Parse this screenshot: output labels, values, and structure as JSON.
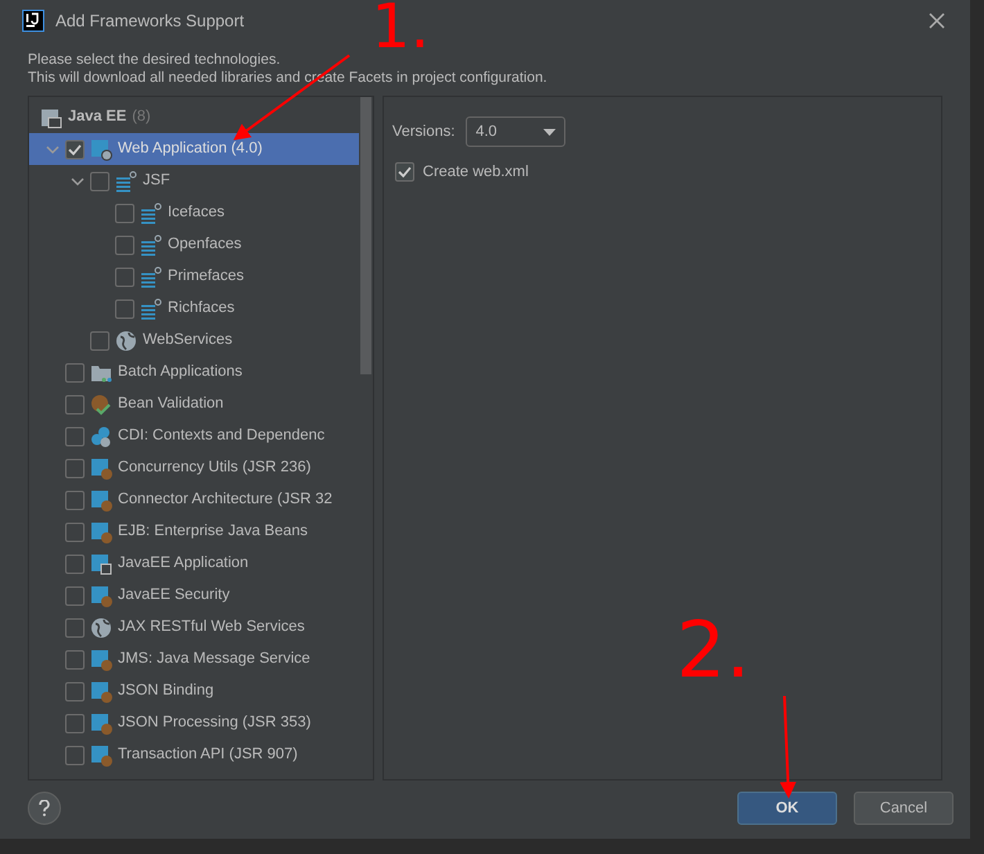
{
  "window": {
    "title": "Add Frameworks Support"
  },
  "description": [
    "Please select the desired technologies.",
    "This will download all needed libraries and create Facets in project configuration."
  ],
  "tree": {
    "group": {
      "label": "Java EE",
      "count": "(8)"
    },
    "items": [
      {
        "label": "Web Application (4.0)",
        "kind": "web",
        "checked": true,
        "selected": true,
        "expanded": true,
        "children": [
          {
            "label": "JSF",
            "kind": "jsf",
            "checked": false,
            "selected": false,
            "expanded": true,
            "children": [
              {
                "label": "Icefaces",
                "kind": "jsf",
                "checked": false,
                "selected": false
              },
              {
                "label": "Openfaces",
                "kind": "jsf",
                "checked": false,
                "selected": false
              },
              {
                "label": "Primefaces",
                "kind": "jsf",
                "checked": false,
                "selected": false
              },
              {
                "label": "Richfaces",
                "kind": "jsf",
                "checked": false,
                "selected": false
              }
            ]
          },
          {
            "label": "WebServices",
            "kind": "globe",
            "checked": false,
            "selected": false
          }
        ]
      },
      {
        "label": "Batch Applications",
        "kind": "folder",
        "checked": false,
        "selected": false
      },
      {
        "label": "Bean Validation",
        "kind": "bean",
        "checked": false,
        "selected": false
      },
      {
        "label": "CDI: Contexts and Dependenc",
        "kind": "cdi",
        "checked": false,
        "selected": false
      },
      {
        "label": "Concurrency Utils (JSR 236)",
        "kind": "module",
        "checked": false,
        "selected": false
      },
      {
        "label": "Connector Architecture (JSR 32",
        "kind": "module",
        "checked": false,
        "selected": false
      },
      {
        "label": "EJB: Enterprise Java Beans",
        "kind": "module",
        "checked": false,
        "selected": false
      },
      {
        "label": "JavaEE Application",
        "kind": "app",
        "checked": false,
        "selected": false
      },
      {
        "label": "JavaEE Security",
        "kind": "module",
        "checked": false,
        "selected": false
      },
      {
        "label": "JAX RESTful Web Services",
        "kind": "globe",
        "checked": false,
        "selected": false
      },
      {
        "label": "JMS: Java Message Service",
        "kind": "module",
        "checked": false,
        "selected": false
      },
      {
        "label": "JSON Binding",
        "kind": "module",
        "checked": false,
        "selected": false
      },
      {
        "label": "JSON Processing (JSR 353)",
        "kind": "module",
        "checked": false,
        "selected": false
      },
      {
        "label": "Transaction API (JSR 907)",
        "kind": "module",
        "checked": false,
        "selected": false
      }
    ]
  },
  "settings": {
    "versions_label": "Versions:",
    "version": "4.0",
    "create_web_xml": {
      "label": "Create web.xml",
      "checked": true
    }
  },
  "buttons": [
    {
      "label": "OK",
      "kind": "primary"
    },
    {
      "label": "Cancel",
      "kind": "secondary"
    }
  ],
  "annotations": [
    {
      "text": "1."
    },
    {
      "text": "2."
    }
  ]
}
